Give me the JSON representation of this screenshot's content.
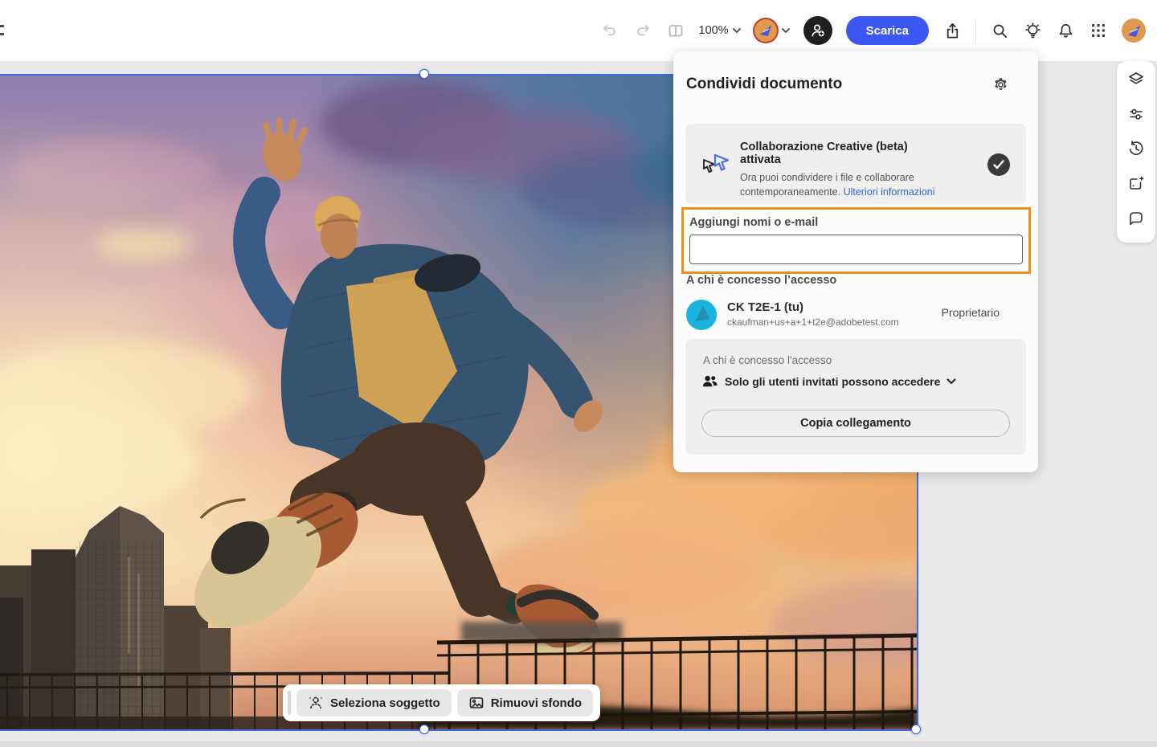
{
  "topbar": {
    "zoom_value": "100%",
    "download_label": "Scarica"
  },
  "share_panel": {
    "title": "Condividi documento",
    "collab_banner": {
      "title": "Collaborazione Creative (beta) attivata",
      "line1": "Ora puoi condividere i file e collaborare",
      "line2": "contemporaneamente.",
      "link": "Ulteriori informazioni"
    },
    "add_field": {
      "label": "Aggiungi nomi o e-mail",
      "value": ""
    },
    "access_heading": "A chi è concesso l’accesso",
    "owner": {
      "name": "CK T2E-1 (tu)",
      "email": "ckaufman+us+a+1+t2e@adobetest.com",
      "role": "Proprietario"
    },
    "link_box": {
      "heading": "A chi è concesso l'accesso",
      "access_value": "Solo gli utenti invitati possono accedere",
      "copy_button": "Copia collegamento"
    }
  },
  "canvas_toolbar": {
    "select_subject": "Seleziona soggetto",
    "remove_background": "Rimuovi sfondo"
  },
  "colors": {
    "accent_blue": "#3b58f2",
    "highlight_orange": "#e8941a",
    "selection_blue": "#3e6be0",
    "panel_gray": "#efefef"
  }
}
